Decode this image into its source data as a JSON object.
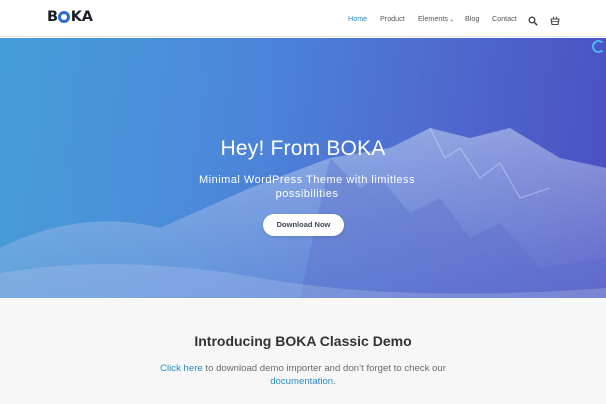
{
  "header": {
    "logo_text": {
      "b": "B",
      "ka": "KA"
    },
    "nav": [
      {
        "label": "Home",
        "active": true
      },
      {
        "label": "Product",
        "active": false
      },
      {
        "label": "Elements",
        "active": false,
        "has_dropdown": true
      },
      {
        "label": "Blog",
        "active": false
      },
      {
        "label": "Contact",
        "active": false
      }
    ],
    "icons": [
      "search-icon",
      "cart-icon"
    ]
  },
  "hero": {
    "title": "Hey! From BOKA",
    "subtitle": "Minimal WordPress Theme with limitless possibilities",
    "button_label": "Download Now"
  },
  "intro": {
    "title": "Introducing BOKA Classic Demo",
    "link1": "Click here",
    "text1": " to download demo importer and don’t forget to check our ",
    "link2": "documentation",
    "text2": "."
  },
  "colors": {
    "accent": "#2a8bc4",
    "logo_ring": "#2b6cd4",
    "hero_gradient_start": "#2e8fd0",
    "hero_gradient_end": "#4a4fc2",
    "intro_bg": "#f7f7f7"
  }
}
